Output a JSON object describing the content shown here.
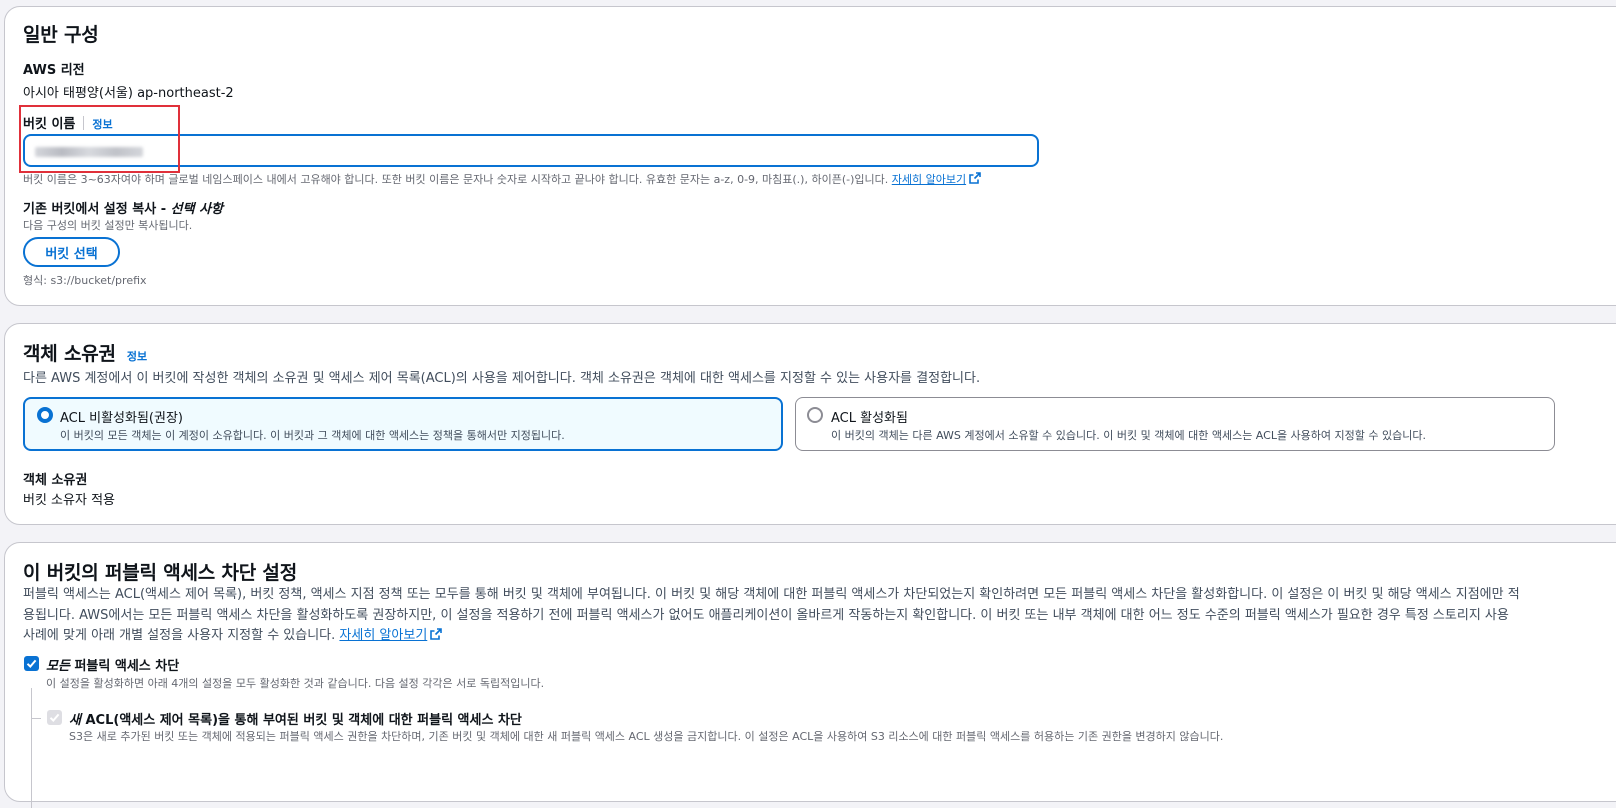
{
  "general": {
    "title": "일반 구성",
    "region_label": "AWS 리전",
    "region_value": "아시아 태평양(서울) ap-northeast-2",
    "bucket_name_label": "버킷 이름",
    "info_link": "정보",
    "bucket_name_hint": "버킷 이름은 3~63자여야 하며 글로벌 네임스페이스 내에서 고유해야 합니다. 또한 버킷 이름은 문자나 숫자로 시작하고 끝나야 합니다. 유효한 문자는 a-z, 0-9, 마침표(.), 하이픈(-)입니다.",
    "learn_more": "자세히 알아보기",
    "copy_label": "기존 버킷에서 설정 복사 - ",
    "copy_optional": "선택 사항",
    "copy_desc": "다음 구성의 버킷 설정만 복사됩니다.",
    "select_bucket_button": "버킷 선택",
    "format_hint": "형식: s3://bucket/prefix"
  },
  "ownership": {
    "title": "객체 소유권",
    "info_link": "정보",
    "desc": "다른 AWS 계정에서 이 버킷에 작성한 객체의 소유권 및 액세스 제어 목록(ACL)의 사용을 제어합니다. 객체 소유권은 객체에 대한 액세스를 지정할 수 있는 사용자를 결정합니다.",
    "options": [
      {
        "title": "ACL 비활성화됨(권장)",
        "desc": "이 버킷의 모든 객체는 이 계정이 소유합니다. 이 버킷과 그 객체에 대한 액세스는 정책을 통해서만 지정됩니다.",
        "selected": true
      },
      {
        "title": "ACL 활성화됨",
        "desc": "이 버킷의 객체는 다른 AWS 계정에서 소유할 수 있습니다. 이 버킷 및 객체에 대한 액세스는 ACL을 사용하여 지정할 수 있습니다.",
        "selected": false
      }
    ],
    "owner_label": "객체 소유권",
    "owner_value": "버킷 소유자 적용"
  },
  "public_access": {
    "title": "이 버킷의 퍼블릭 액세스 차단 설정",
    "desc_line1": "퍼블릭 액세스는 ACL(액세스 제어 목록), 버킷 정책, 액세스 지점 정책 또는 모두를 통해 버킷 및 객체에 부여됩니다. 이 버킷 및 해당 객체에 대한 퍼블릭 액세스가 차단되었는지 확인하려면 모든 퍼블릭 액세스 차단을 활성화합니다. 이 설정은 이 버킷 및 해당 액세스 지점에만 적",
    "desc_line2": "용됩니다. AWS에서는 모든 퍼블릭 액세스 차단을 활성화하도록 권장하지만, 이 설정을 적용하기 전에 퍼블릭 액세스가 없어도 애플리케이션이 올바르게 작동하는지 확인합니다. 이 버킷 또는 내부 객체에 대한 어느 정도 수준의 퍼블릭 액세스가 필요한 경우 특정 스토리지 사용",
    "desc_line3": "사례에 맞게 아래 개별 설정을 사용자 지정할 수 있습니다.",
    "learn_more": "자세히 알아보기",
    "block_all_em": "모든",
    "block_all_rest": " 퍼블릭 액세스 차단",
    "block_all_desc": "이 설정을 활성화하면 아래 4개의 설정을 모두 활성화한 것과 같습니다. 다음 설정 각각은 서로 독립적입니다.",
    "sub1_em": "새",
    "sub1_rest": " ACL(액세스 제어 목록)을 통해 부여된 버킷 및 객체에 대한 퍼블릭 액세스 차단",
    "sub1_desc": "S3은 새로 추가된 버킷 또는 객체에 적용되는 퍼블릭 액세스 권한을 차단하며, 기존 버킷 및 객체에 대한 새 퍼블릭 액세스 ACL 생성을 금지합니다. 이 설정은 ACL을 사용하여 S3 리소스에 대한 퍼블릭 액세스를 허용하는 기존 권한을 변경하지 않습니다."
  },
  "colors": {
    "accent": "#0972d3",
    "highlight": "#e0303a",
    "border": "#c6c6cd"
  }
}
